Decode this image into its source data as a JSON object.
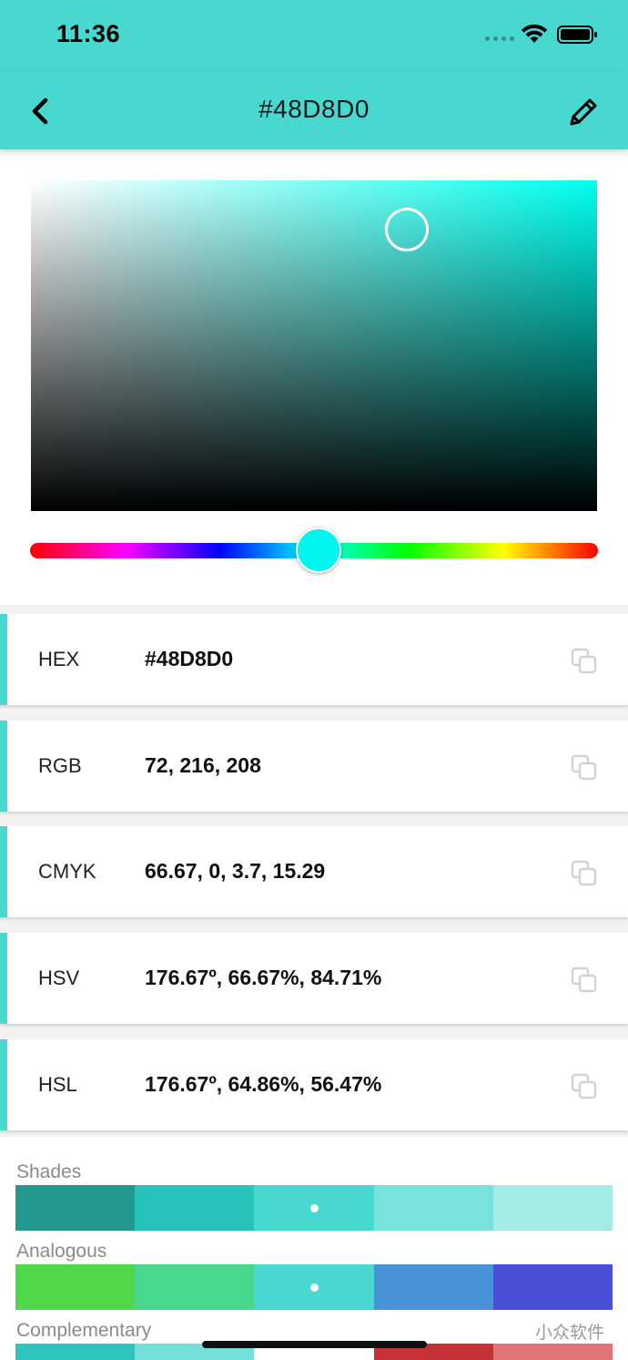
{
  "status_bar": {
    "time": "11:36"
  },
  "nav": {
    "title": "#48D8D0",
    "back_icon": "chevron-left-icon",
    "edit_icon": "pencil-icon"
  },
  "picker": {
    "hue_color": "#00FFEE",
    "thumb_color": "#00F5EE",
    "hue_position": 0.49,
    "saturation": 0.67,
    "value": 0.85
  },
  "values": [
    {
      "label": "HEX",
      "value": "#48D8D0"
    },
    {
      "label": "RGB",
      "value": "72, 216, 208"
    },
    {
      "label": "CMYK",
      "value": "66.67, 0, 3.7, 15.29"
    },
    {
      "label": "HSV",
      "value": "176.67º, 66.67%, 84.71%"
    },
    {
      "label": "HSL",
      "value": "176.67º, 64.86%, 56.47%"
    }
  ],
  "palettes": {
    "shades": {
      "title": "Shades",
      "colors": [
        "#21998F",
        "#27C2BA",
        "#48D8D0",
        "#78E3DD",
        "#A3EBE6"
      ],
      "selected_index": 2
    },
    "analogous": {
      "title": "Analogous",
      "colors": [
        "#4FD84A",
        "#48D88D",
        "#48D8D0",
        "#4893D8",
        "#4A4FD8"
      ],
      "selected_index": 2
    },
    "complementary": {
      "title": "Complementary",
      "colors": [
        "#2CC4BB",
        "#73E1DA",
        "#ffffff",
        "#C43236",
        "#E27478"
      ]
    }
  },
  "watermark": "小众软件"
}
